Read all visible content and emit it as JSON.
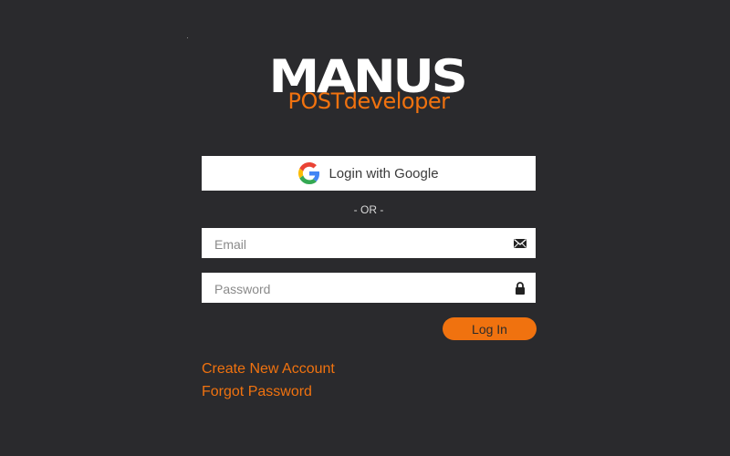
{
  "logo": {
    "main": "MANUS",
    "sub": "POSTdeveloper"
  },
  "google": {
    "label": "Login with Google"
  },
  "divider": {
    "text": "- OR -"
  },
  "email": {
    "placeholder": "Email",
    "value": ""
  },
  "password": {
    "placeholder": "Password",
    "value": ""
  },
  "login": {
    "label": "Log In"
  },
  "links": {
    "create_account": "Create New Account",
    "forgot_password": "Forgot Password"
  },
  "icons": {
    "google": "google-logo-icon",
    "email": "envelope-icon",
    "password": "lock-icon"
  },
  "colors": {
    "background": "#2a2a2d",
    "accent": "#f0720f",
    "field": "#ffffff"
  }
}
